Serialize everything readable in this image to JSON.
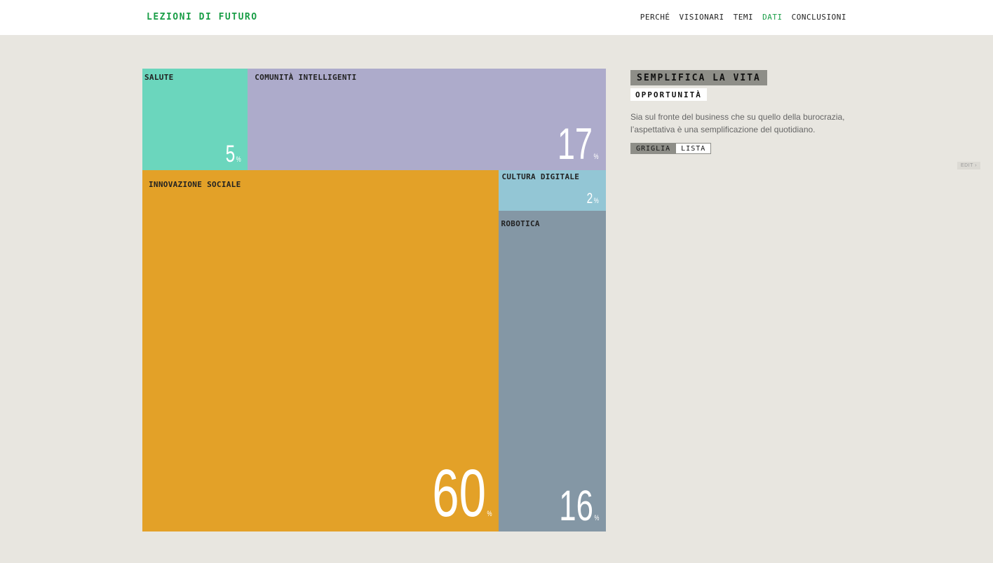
{
  "header": {
    "logo": "LEZIONI DI FUTURO",
    "nav": [
      {
        "label": "PERCHÉ",
        "active": false
      },
      {
        "label": "VISIONARI",
        "active": false
      },
      {
        "label": "TEMI",
        "active": false
      },
      {
        "label": "DATI",
        "active": true
      },
      {
        "label": "CONCLUSIONI",
        "active": false
      }
    ]
  },
  "treemap": {
    "cells": [
      {
        "label": "SALUTE",
        "value": 5,
        "unit": "%",
        "color": "#6bd6bd"
      },
      {
        "label": "COMUNITÀ INTELLIGENTI",
        "value": 17,
        "unit": "%",
        "color": "#adabcb"
      },
      {
        "label": "INNOVAZIONE SOCIALE",
        "value": 60,
        "unit": "%",
        "color": "#e3a128"
      },
      {
        "label": "CULTURA DIGITALE",
        "value": 2,
        "unit": "%",
        "color": "#93c6d5"
      },
      {
        "label": "ROBOTICA",
        "value": 16,
        "unit": "%",
        "color": "#8497a5"
      }
    ]
  },
  "sidebar": {
    "title": "SEMPLIFICA LA VITA",
    "subtitle": "OPPORTUNITÀ",
    "description": "Sia sul fronte del business che su quello della burocrazia, l’aspettativa è una semplificazione del quotidiano.",
    "view_toggle": {
      "grid_label": "GRIGLIA",
      "list_label": "LISTA"
    }
  },
  "edit_label": "EDIT ›"
}
